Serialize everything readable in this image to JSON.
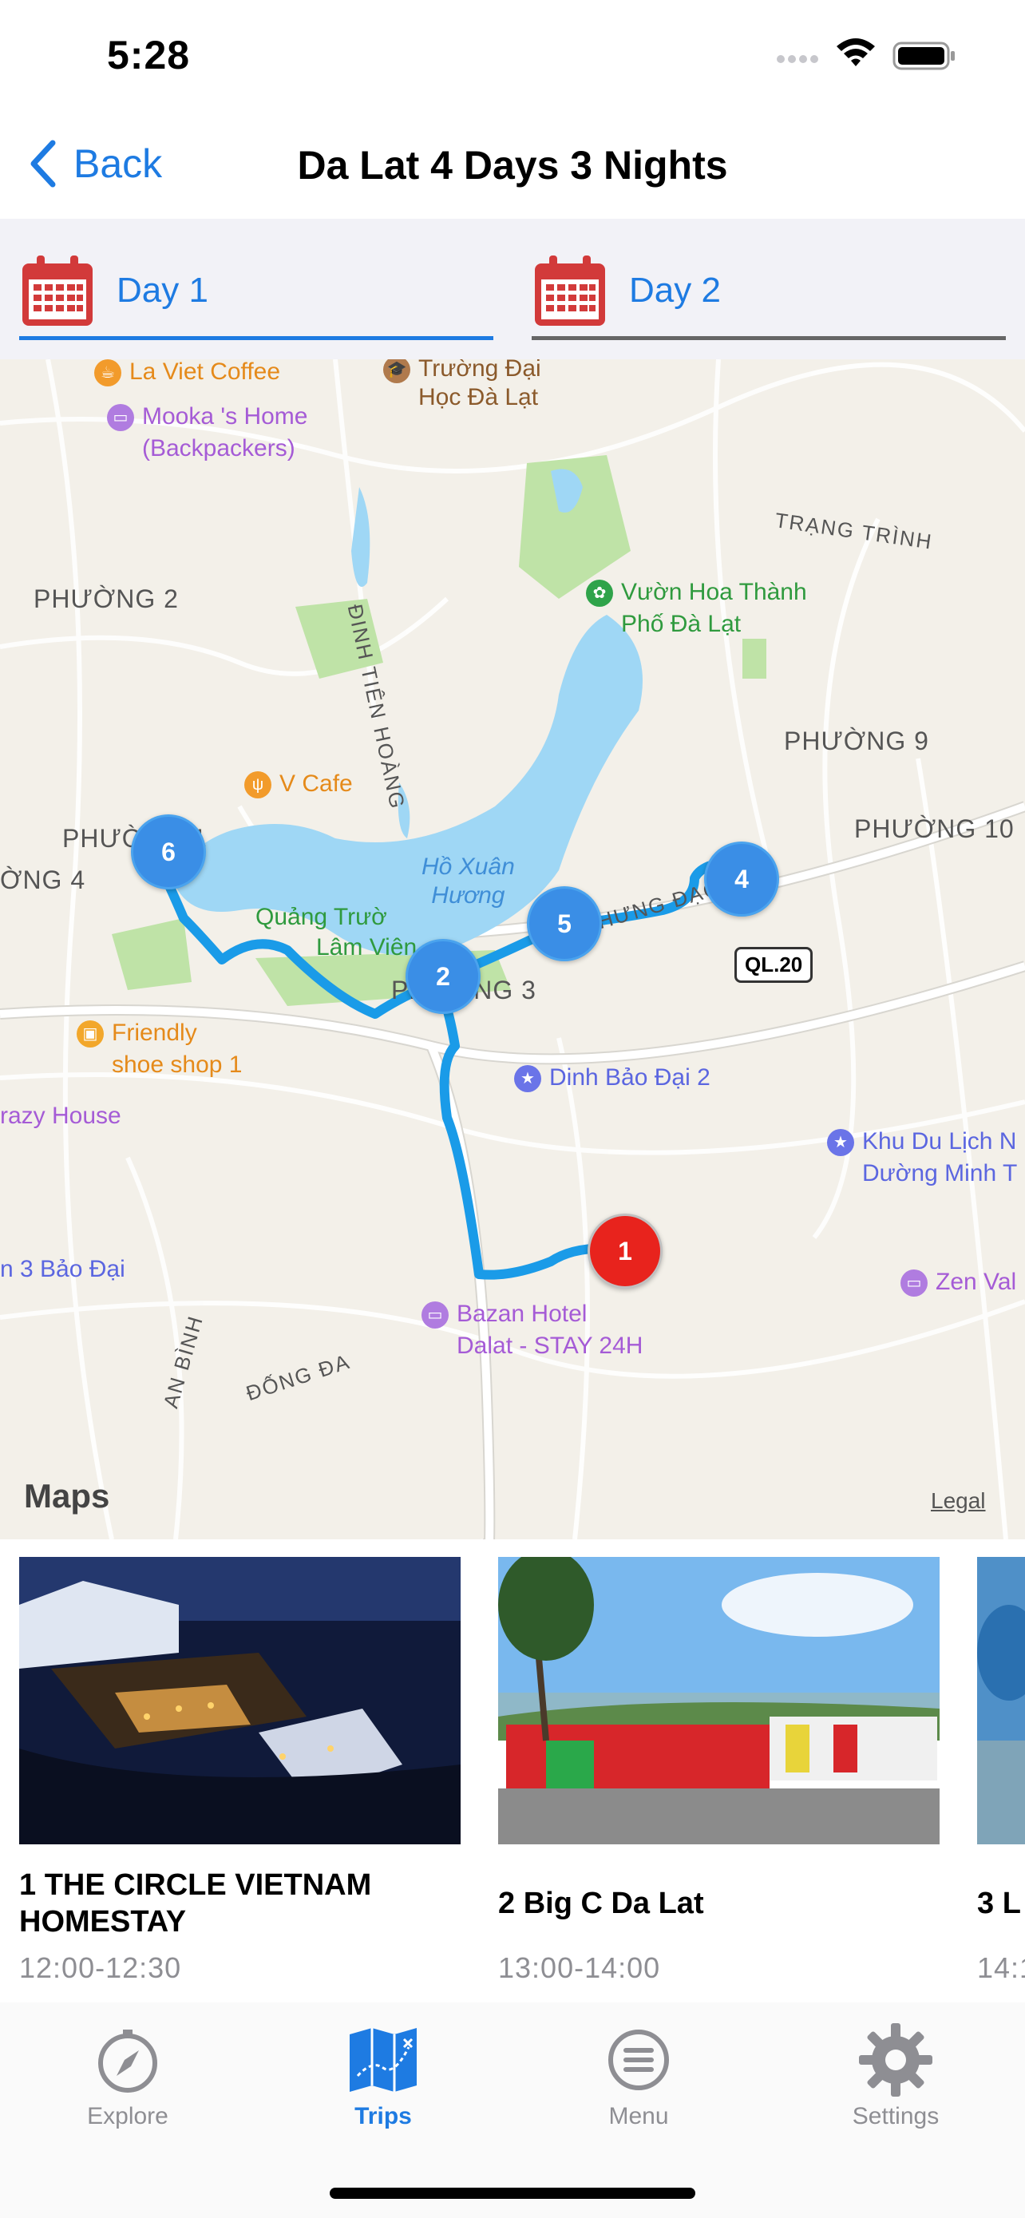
{
  "status_bar": {
    "time": "5:28"
  },
  "nav": {
    "back_label": "Back",
    "title": "Da Lat 4 Days 3 Nights"
  },
  "day_tabs": [
    {
      "label": "Day 1",
      "selected": true
    },
    {
      "label": "Day 2",
      "selected": false
    }
  ],
  "map": {
    "pois": {
      "la_viet": "La Viet Coffee",
      "truong": "Trường Đại",
      "hoc": "Học Đà Lạt",
      "mooka_1": "Mooka 's Home",
      "mooka_2": "(Backpackers)",
      "trang_trinh": "TRẠNG TRÌNH",
      "vuon_1": "Vườn Hoa Thành",
      "vuon_2": "Phố Đà Lạt",
      "phuong2": "PHƯỜNG 2",
      "dinh_tien_hoang": "ĐINH TIÊN HOÀNG",
      "phuong9": "PHƯỜNG 9",
      "v_cafe": "V Cafe",
      "ho_1": "Hồ Xuân",
      "ho_2": "Hương",
      "phuong10": "PHƯỜNG 10",
      "phuong1": "PHƯỜNG 1",
      "ql20": "QL.20",
      "phuong4": "ỜNG 4",
      "quang_1": "Quảng Trườ",
      "quang_2": "Lâm Viên",
      "tran_hung_dao": "TRẦN HƯNG ĐẠO",
      "friendly_1": "Friendly",
      "friendly_2": "shoe shop 1",
      "dinh_bao_dai": "Dinh Bảo Đại 2",
      "crazy": "razy House",
      "khu_1": "Khu Du Lịch N",
      "khu_2": "Dường Minh T",
      "phuong3": "PHƯỜNG 3",
      "bao_dai": "n 3 Bảo Đại",
      "zen": "Zen Val",
      "bazan_1": "Bazan Hotel",
      "bazan_2": "Dalat - STAY 24H",
      "an_binh": "AN BÌNH",
      "dong_da": "ĐỐNG ĐA"
    },
    "pins": [
      "1",
      "2",
      "4",
      "5",
      "6"
    ],
    "maps_label": "Maps",
    "legal": "Legal"
  },
  "cards": [
    {
      "title": "1 THE CIRCLE VIETNAM HOMESTAY",
      "time": "12:00-12:30"
    },
    {
      "title": "2 Big C Da Lat",
      "time": "13:00-14:00"
    },
    {
      "title": "3 L",
      "time": "14:1"
    }
  ],
  "tab_bar": [
    {
      "label": "Explore",
      "icon": "compass-icon",
      "active": false
    },
    {
      "label": "Trips",
      "icon": "map-icon",
      "active": true
    },
    {
      "label": "Menu",
      "icon": "menu-icon",
      "active": false
    },
    {
      "label": "Settings",
      "icon": "gear-icon",
      "active": false
    }
  ],
  "colors": {
    "accent": "#1e7be2",
    "route": "#1a9be8",
    "pin_blue": "#3a8ee6",
    "pin_red": "#e8231d",
    "calendar": "#d23a3a"
  }
}
